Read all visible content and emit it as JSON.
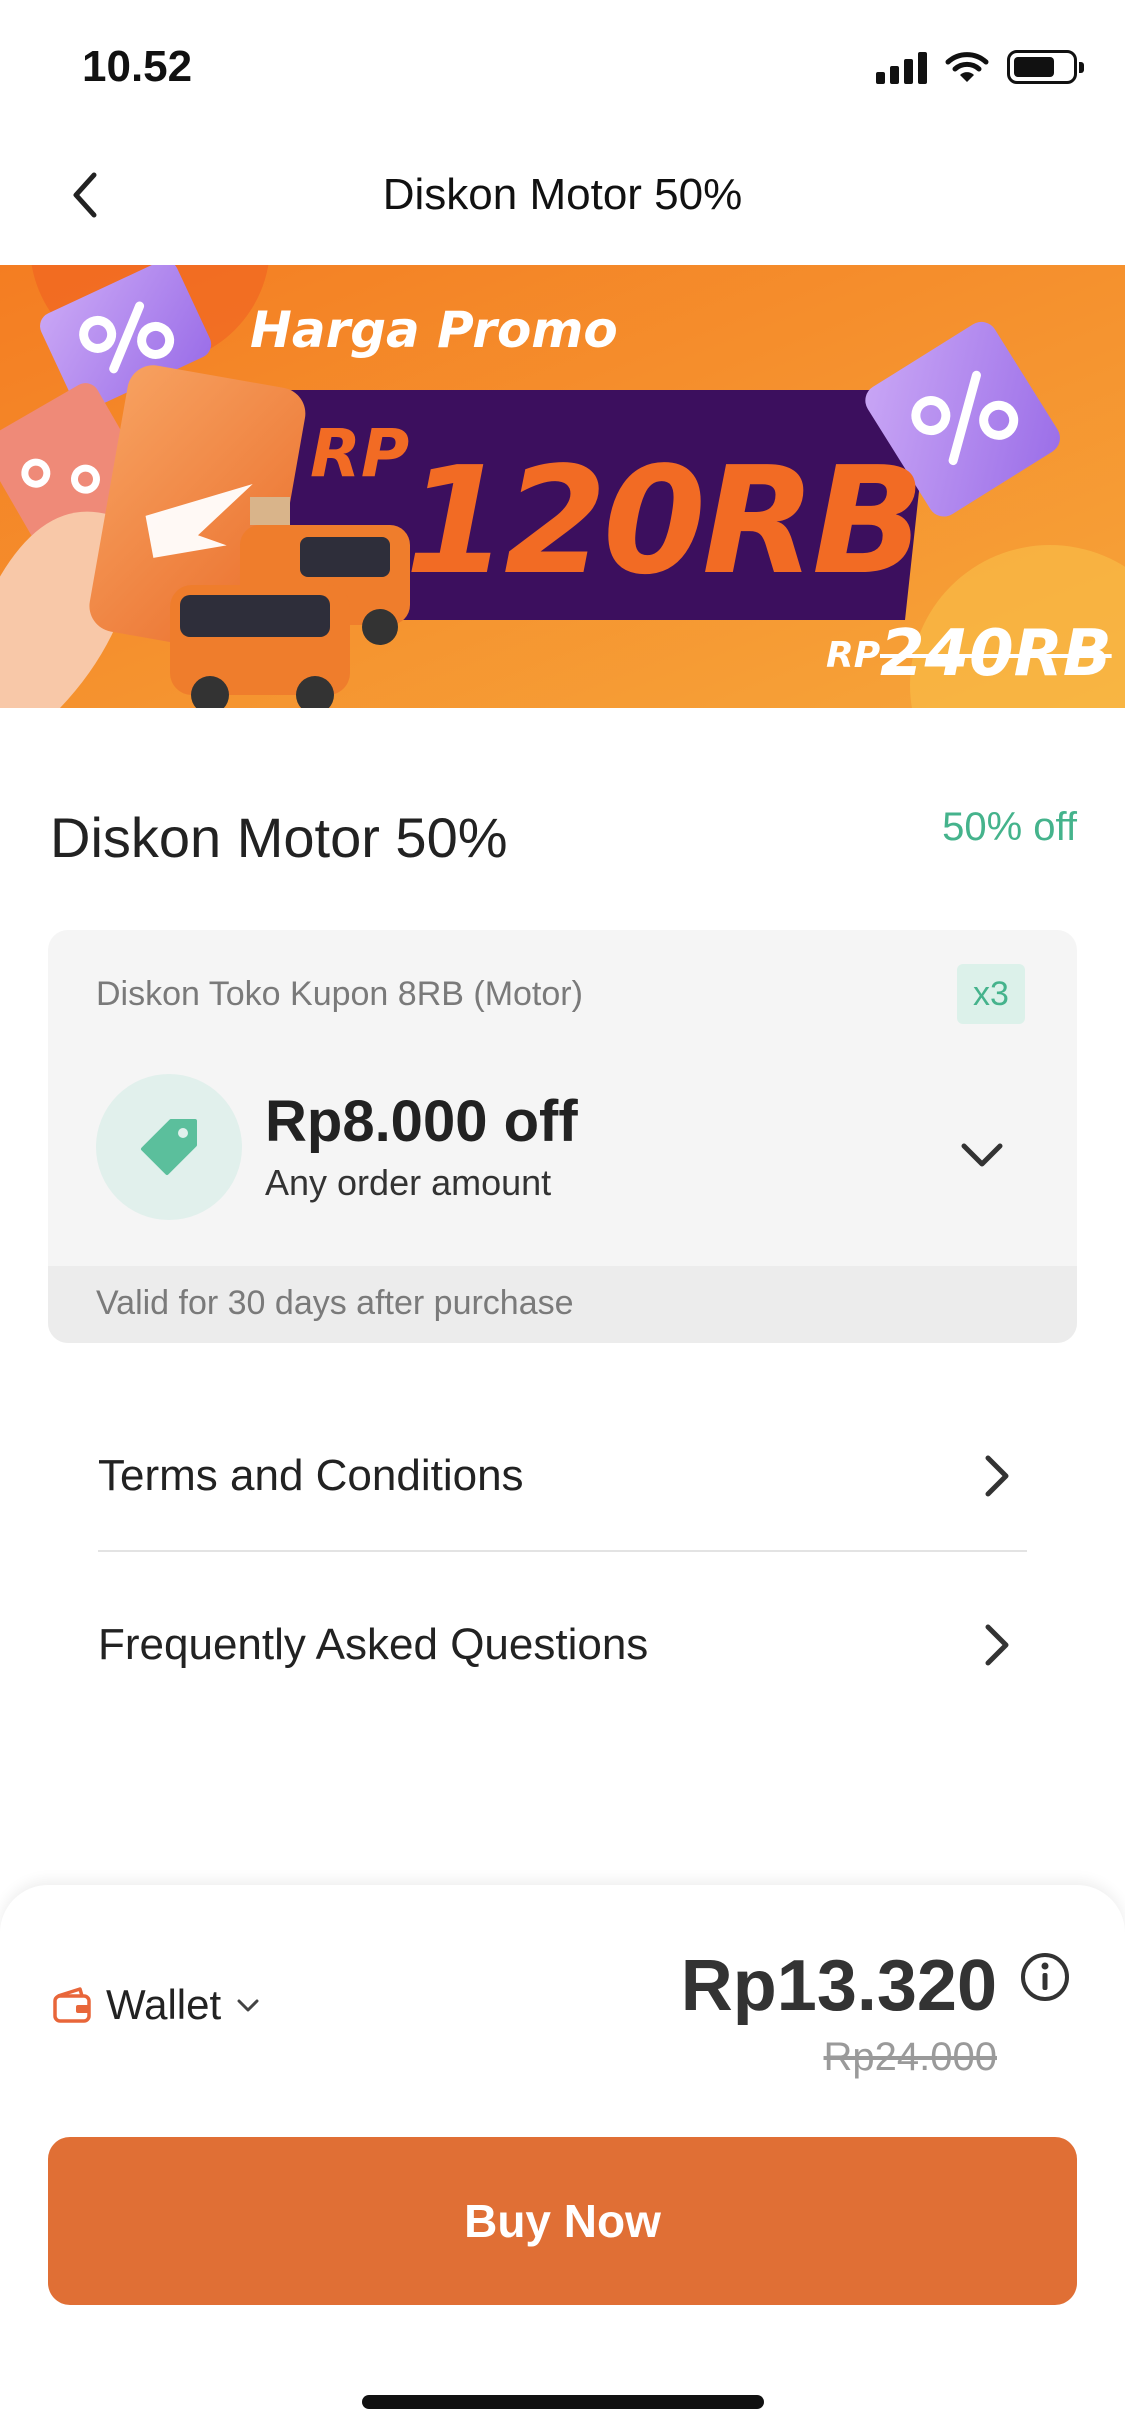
{
  "status_bar": {
    "time": "10.52"
  },
  "nav": {
    "title": "Diskon Motor 50%"
  },
  "banner": {
    "promo_label": "Harga Promo",
    "promo_currency": "RP",
    "promo_price": "120RB",
    "original_currency": "RP",
    "original_price": "240RB",
    "colors": {
      "background": "#f2892a",
      "panel": "#3c0f5e",
      "accent": "#f26b24"
    }
  },
  "product": {
    "title": "Diskon Motor 50%",
    "discount": "50% off"
  },
  "voucher": {
    "name": "Diskon Toko Kupon 8RB (Motor)",
    "quantity": "x3",
    "amount": "Rp8.000 off",
    "condition": "Any order amount",
    "validity": "Valid for 30 days after purchase",
    "icon": "tag-icon"
  },
  "links": [
    {
      "label": "Terms and Conditions"
    },
    {
      "label": "Frequently Asked Questions"
    }
  ],
  "checkout": {
    "payment_method": "Wallet",
    "price": "Rp13.320",
    "original_price": "Rp24.000",
    "buy_label": "Buy Now",
    "colors": {
      "button": "#e06f35",
      "accent_green": "#45b38c"
    }
  }
}
